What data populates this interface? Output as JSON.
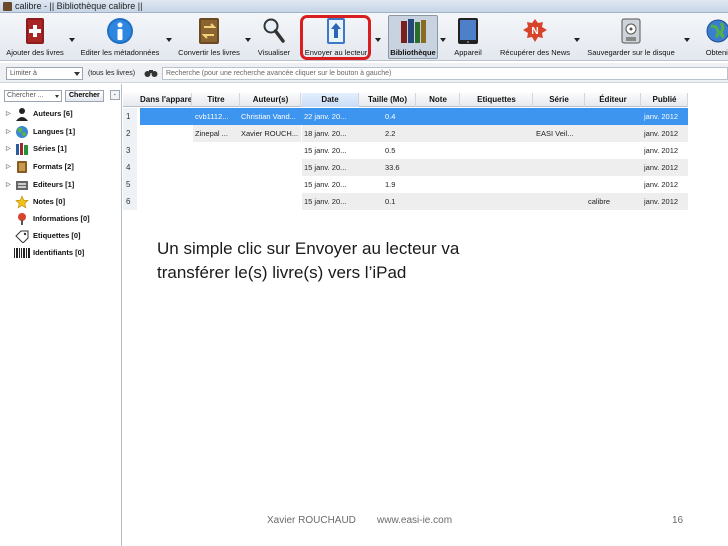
{
  "window": {
    "title": "calibre - || Bibliothèque calibre ||"
  },
  "toolbar": {
    "buttons": [
      {
        "label": "Ajouter des livres",
        "icon": "add-book-icon"
      },
      {
        "label": "Editer les métadonnées",
        "icon": "info-icon"
      },
      {
        "label": "Convertir les livres",
        "icon": "convert-book-icon"
      },
      {
        "label": "Visualiser",
        "icon": "magnifier-icon"
      },
      {
        "label": "Envoyer au lecteur",
        "icon": "send-to-device-icon"
      },
      {
        "label": "Bibliothèque",
        "icon": "library-icon"
      },
      {
        "label": "Appareil",
        "icon": "tablet-icon"
      },
      {
        "label": "Récupérer des News",
        "icon": "news-icon"
      },
      {
        "label": "Sauvegarder sur le disque",
        "icon": "save-disk-icon"
      },
      {
        "label": "Obtenir",
        "icon": "globe-icon"
      }
    ]
  },
  "searchbar": {
    "limit_label": "Limiter à",
    "all_books": "(tous les livres)",
    "placeholder": "Recherche (pour une recherche avancée cliquer sur le bouton à gauche)"
  },
  "tag_browser": {
    "search_placeholder": "Chercher ...",
    "search_button": "Chercher",
    "items": [
      {
        "label": "Auteurs [6]",
        "icon": "authors-icon"
      },
      {
        "label": "Langues [1]",
        "icon": "languages-icon"
      },
      {
        "label": "Séries [1]",
        "icon": "series-icon"
      },
      {
        "label": "Formats [2]",
        "icon": "formats-icon"
      },
      {
        "label": "Editeurs [1]",
        "icon": "publishers-icon"
      },
      {
        "label": "Notes [0]",
        "icon": "rating-star-icon"
      },
      {
        "label": "Informations [0]",
        "icon": "news-pin-icon"
      },
      {
        "label": "Etiquettes [0]",
        "icon": "tags-icon"
      },
      {
        "label": "Identifiants [0]",
        "icon": "barcode-icon"
      }
    ]
  },
  "book_list": {
    "columns": [
      "Dans l'appareil",
      "Titre",
      "Auteur(s)",
      "Date",
      "Taille (Mo)",
      "Note",
      "Etiquettes",
      "Série",
      "Éditeur",
      "Publié"
    ],
    "rows": [
      {
        "num": "1",
        "title": "cvb1112...",
        "author": "Christian Vand...",
        "date": "22 janv. 20...",
        "size": "0.4",
        "series": "",
        "publisher": "",
        "published": "janv. 2012",
        "selected": true
      },
      {
        "num": "2",
        "title": "Zinepal ...",
        "author": "Xavier ROUCH...",
        "date": "18 janv. 20...",
        "size": "2.2",
        "series": "EASI Veil...",
        "publisher": "",
        "published": "janv. 2012",
        "selected": false
      },
      {
        "num": "3",
        "title": "",
        "author": "",
        "date": "15 janv. 20...",
        "size": "0.5",
        "series": "",
        "publisher": "",
        "published": "janv. 2012",
        "selected": false
      },
      {
        "num": "4",
        "title": "",
        "author": "",
        "date": "15 janv. 20...",
        "size": "33.6",
        "series": "",
        "publisher": "",
        "published": "janv. 2012",
        "selected": false
      },
      {
        "num": "5",
        "title": "",
        "author": "",
        "date": "15 janv. 20...",
        "size": "1.9",
        "series": "",
        "publisher": "",
        "published": "janv. 2012",
        "selected": false
      },
      {
        "num": "6",
        "title": "",
        "author": "",
        "date": "15 janv. 20...",
        "size": "0.1",
        "series": "",
        "publisher": "calibre",
        "published": "janv. 2012",
        "selected": false
      }
    ]
  },
  "slide": {
    "caption_line1": "Un simple clic sur Envoyer au lecteur va",
    "caption_line2": "transférer le(s) livre(s) vers l’iPad",
    "author": "Xavier ROUCHAUD",
    "website": "www.easi-ie.com",
    "page_number": "16"
  },
  "colors": {
    "highlight": "#d81e1e",
    "selection": "#3d95f0"
  }
}
